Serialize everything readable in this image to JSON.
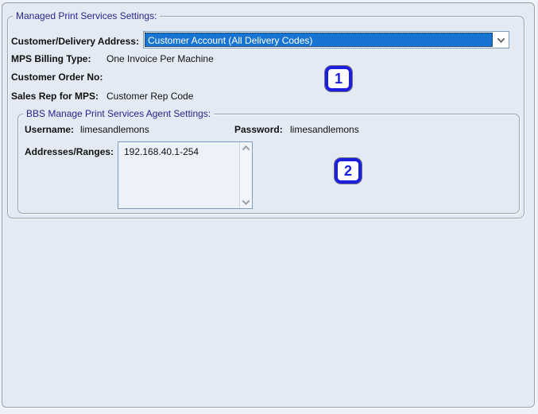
{
  "outer_group": {
    "title": "Managed Print Services Settings:"
  },
  "fields": {
    "customer_delivery_address": {
      "label": "Customer/Delivery Address:",
      "value": "Customer Account (All Delivery Codes)"
    },
    "mps_billing_type": {
      "label": "MPS Billing Type:",
      "value": "One Invoice Per Machine"
    },
    "customer_order_no": {
      "label": "Customer Order No:",
      "value": ""
    },
    "sales_rep_for_mps": {
      "label": "Sales Rep for MPS:",
      "value": "Customer Rep Code"
    }
  },
  "inner_group": {
    "title": "BBS Manage Print Services Agent Settings:",
    "username": {
      "label": "Username:",
      "value": "limesandlemons"
    },
    "password": {
      "label": "Password:",
      "value": "limesandlemons"
    },
    "addresses_ranges": {
      "label": "Addresses/Ranges:",
      "value": "192.168.40.1-254"
    }
  },
  "annotations": {
    "mark1": "1",
    "mark2": "2"
  },
  "icons": {
    "combo_arrow": "chevron-down-icon",
    "scroll_up": "chevron-up-icon",
    "scroll_down": "chevron-down-icon"
  },
  "colors": {
    "selection_blue": "#1874d2",
    "group_title_navy": "#26268e",
    "annotation_blue": "#1d1ddf",
    "panel_background": "#e4eaf3",
    "border_gray": "#9aa3ae",
    "field_border_blue": "#7a9cc0"
  }
}
